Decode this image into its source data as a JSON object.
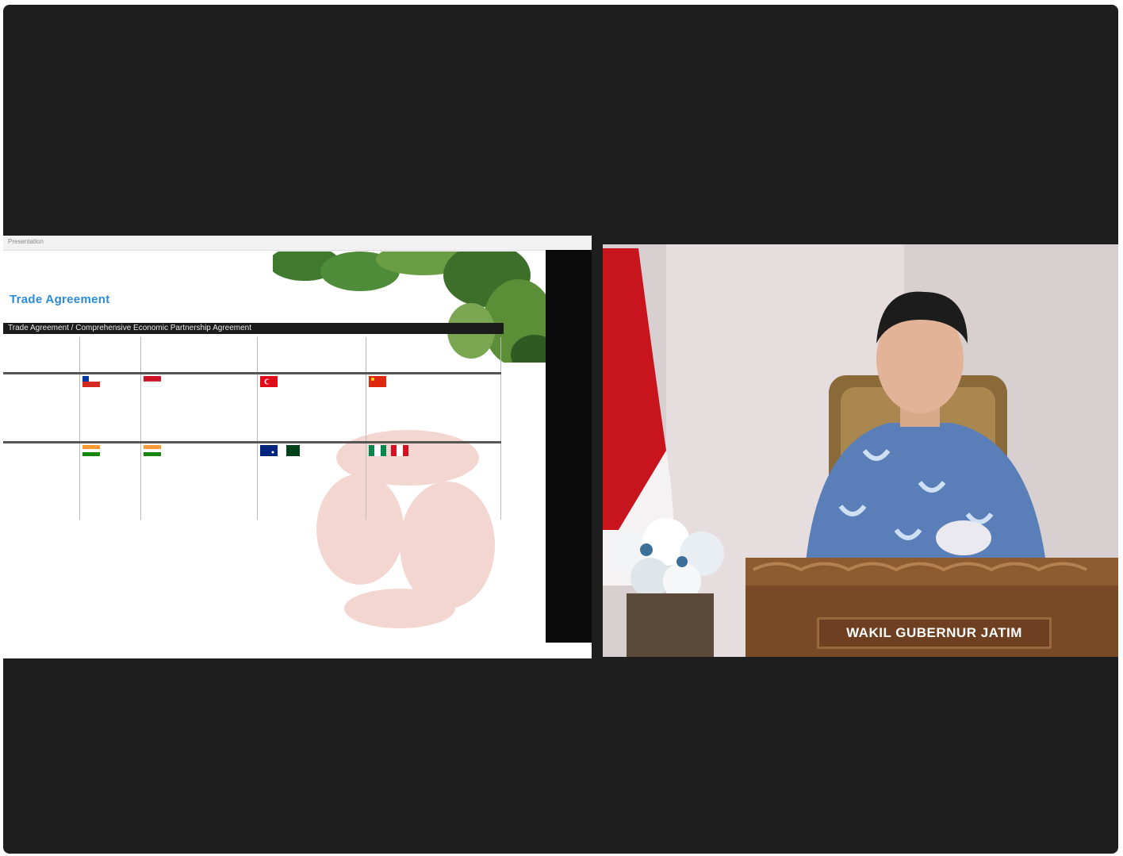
{
  "shared_screen": {
    "slide_title": "Trade Agreement",
    "header_bar": "Trade Agreement / Comprehensive Economic Partnership Agreement",
    "tab_hint": "Presentation"
  },
  "speaker": {
    "nameplate": "WAKIL GUBERNUR JATIM"
  },
  "colors": {
    "meeting_background": "#1e1e1e",
    "slide_title": "#2a8bd6",
    "nameplate": "#6e3f20"
  },
  "flags": [
    "chile-flag",
    "indonesia-flag",
    "turkey-flag",
    "china-flag",
    "india-flag",
    "india-flag-2",
    "australia-flag",
    "pakistan-flag",
    "nigeria-flag",
    "peru-flag"
  ]
}
